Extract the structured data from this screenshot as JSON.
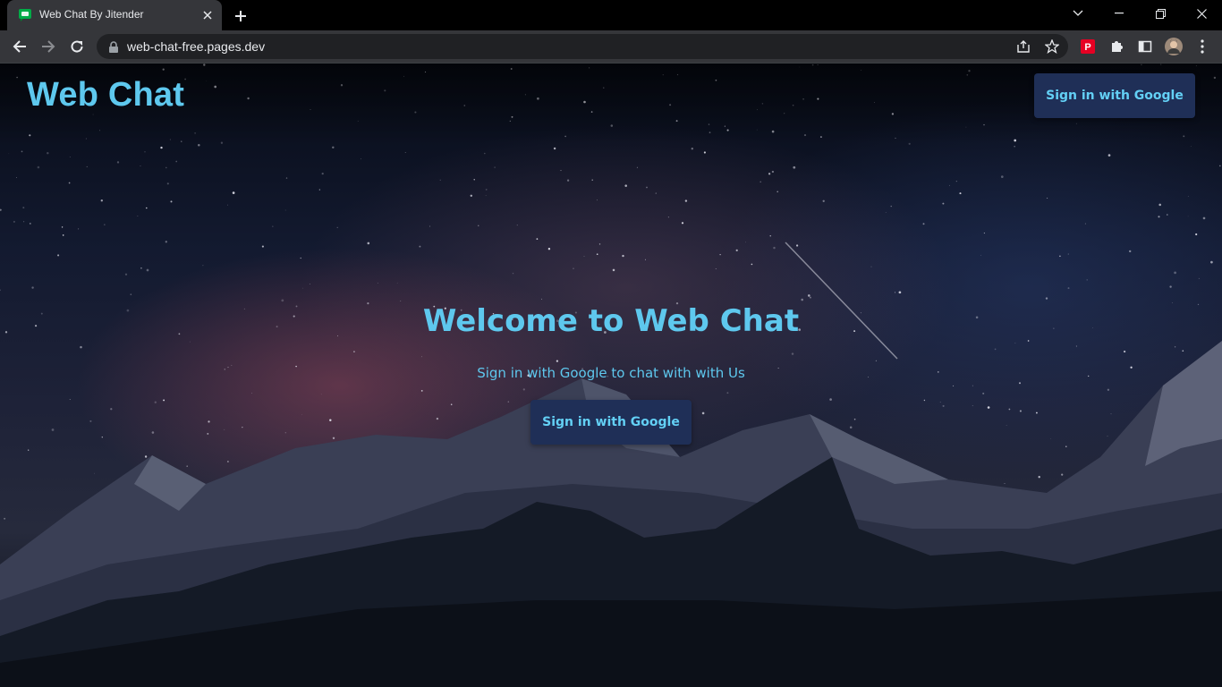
{
  "browser": {
    "tab": {
      "title": "Web Chat By Jitender",
      "favicon": "google-chat-icon"
    },
    "url": "web-chat-free.pages.dev",
    "icons": [
      "back-icon",
      "forward-icon",
      "reload-icon",
      "lock-icon",
      "share-icon",
      "star-icon",
      "pinterest-icon",
      "puzzle-icon",
      "side-panel-icon",
      "avatar",
      "kebab-menu-icon"
    ]
  },
  "header": {
    "logo": "Web Chat",
    "signin_label": "Sign in with Google"
  },
  "hero": {
    "title": "Welcome to Web Chat",
    "subtitle": "Sign in with Google to chat with with Us",
    "signin_label": "Sign in with Google"
  },
  "colors": {
    "accent": "#5ec8ee",
    "button_bg": "#1f2f57",
    "chrome_bg": "#35363a"
  }
}
